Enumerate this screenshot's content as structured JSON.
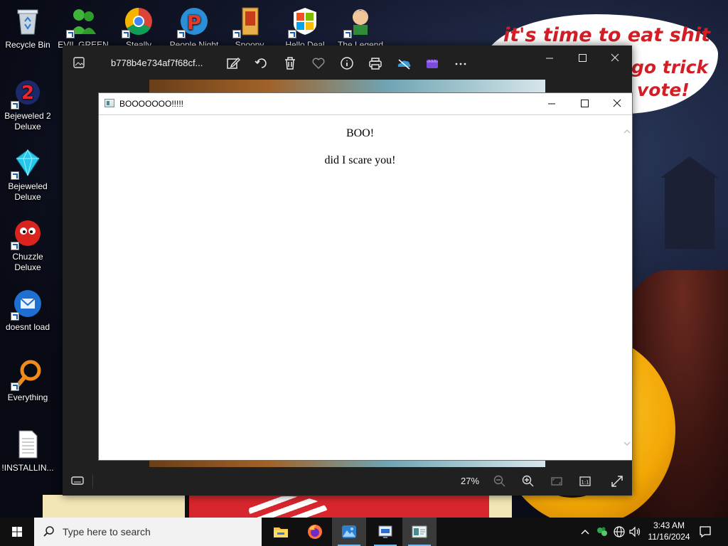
{
  "wallpaper": {
    "bubble": [
      "it's time to eat shit",
      "go trick",
      "vote!"
    ]
  },
  "desktop_icons": [
    {
      "label": "Recycle Bin",
      "icon": "recycle-bin-icon"
    },
    {
      "label": "Bejeweled 2 Deluxe",
      "icon": "bejeweled-2-icon"
    },
    {
      "label": "Bejeweled Deluxe",
      "icon": "bejeweled-icon"
    },
    {
      "label": "Chuzzle Deluxe",
      "icon": "chuzzle-icon"
    },
    {
      "label": "doesnt load",
      "icon": "thunderbird-icon"
    },
    {
      "label": "Everything",
      "icon": "everything-search-icon"
    },
    {
      "label": "!INSTALLIN...",
      "icon": "text-file-icon"
    },
    {
      "label": "EVIL GREEN",
      "icon": "msn-people-icon"
    },
    {
      "label": "Steally",
      "icon": "chrome-icon"
    },
    {
      "label": "People Night",
      "icon": "peggle-icon"
    },
    {
      "label": "Spoopy",
      "icon": "folder-icon"
    },
    {
      "label": "Hello Deal",
      "icon": "windows-logo-icon"
    },
    {
      "label": "The Legend",
      "icon": "game-character-icon"
    }
  ],
  "photos_viewer": {
    "filename": "b778b4e734af7f68cf...",
    "toolbar": [
      "edit-image-icon",
      "rotate-icon",
      "delete-icon",
      "favorite-icon",
      "info-icon",
      "print-icon",
      "onedrive-icon",
      "video-editor-icon",
      "more-options-icon"
    ],
    "zoom": "27%"
  },
  "dialog": {
    "title": "BOOOOOOO!!!!!",
    "line1": "BOO!",
    "line2": "did I scare you!"
  },
  "taskbar": {
    "search_placeholder": "Type here to search",
    "apps": [
      "file-explorer-icon",
      "firefox-icon",
      "photos-icon",
      "remote-app-icon",
      "window-app-icon"
    ],
    "time": "3:43 AM",
    "date": "11/16/2024"
  }
}
